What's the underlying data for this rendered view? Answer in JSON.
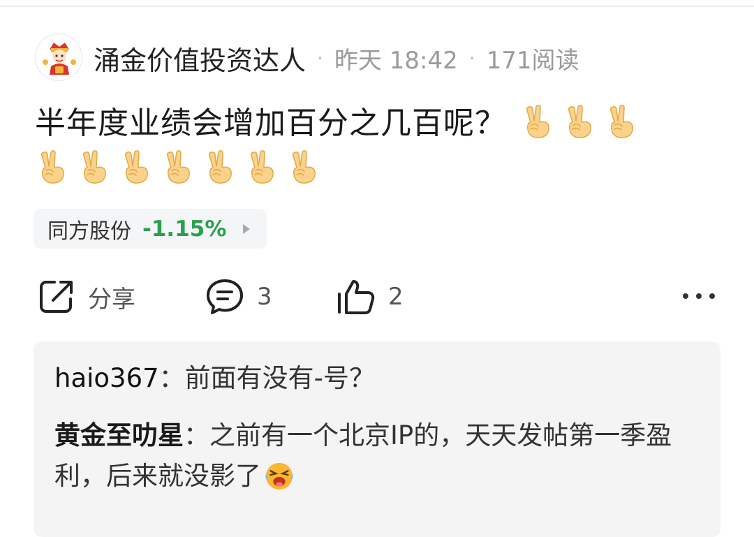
{
  "author": {
    "name": "涌金价值投资达人",
    "time": "昨天 18:42",
    "views": "171阅读",
    "separator": "·"
  },
  "post": {
    "text": "半年度业绩会增加百分之几百呢？",
    "emoji_icon": "victory-hand-icon",
    "emoji_count": 10
  },
  "stock": {
    "name": "同方股份",
    "change": "-1.15%",
    "change_color": "#2aa04f"
  },
  "actions": {
    "share_label": "分享",
    "comment_count": "3",
    "like_count": "2"
  },
  "comments": [
    {
      "user": "haio367",
      "sep": "：",
      "text": "前面有没有-号？"
    },
    {
      "user": "黄金至叻星",
      "sep": "：",
      "text": "之前有一个北京IP的，天天发帖第一季盈利，后来就没影了"
    }
  ],
  "colors": {
    "accent_green": "#2aa04f",
    "muted": "#9b9b9b",
    "card_bg": "#f4f4f5"
  }
}
